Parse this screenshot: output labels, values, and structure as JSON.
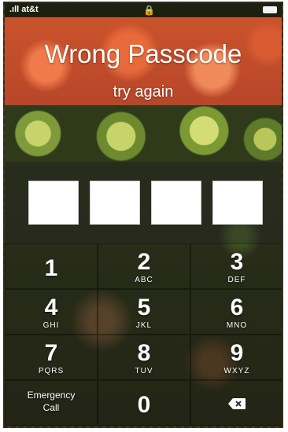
{
  "status_bar": {
    "carrier": ".ıll at&t",
    "lock_icon": "lock-icon",
    "battery_icon": "battery-icon"
  },
  "header": {
    "title": "Wrong Passcode",
    "subtitle": "try again"
  },
  "passcode": {
    "box_count": 4
  },
  "keypad": {
    "keys": [
      {
        "digit": "1",
        "letters": ""
      },
      {
        "digit": "2",
        "letters": "ABC"
      },
      {
        "digit": "3",
        "letters": "DEF"
      },
      {
        "digit": "4",
        "letters": "GHI"
      },
      {
        "digit": "5",
        "letters": "JKL"
      },
      {
        "digit": "6",
        "letters": "MNO"
      },
      {
        "digit": "7",
        "letters": "PQRS"
      },
      {
        "digit": "8",
        "letters": "TUV"
      },
      {
        "digit": "9",
        "letters": "WXYZ"
      },
      {
        "digit": "0",
        "letters": ""
      }
    ],
    "emergency_call_label": "Emergency\nCall",
    "delete_icon": "delete-backspace-icon"
  }
}
